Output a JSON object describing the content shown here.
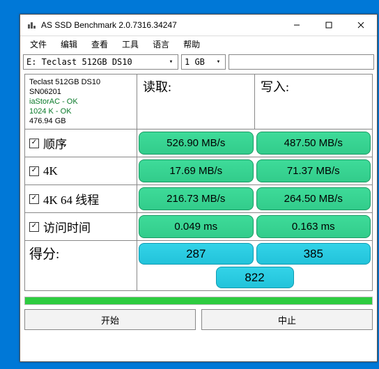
{
  "window": {
    "title": "AS SSD Benchmark 2.0.7316.34247"
  },
  "menu": {
    "file": "文件",
    "edit": "编辑",
    "view": "查看",
    "tools": "工具",
    "language": "语言",
    "help": "帮助"
  },
  "toolbar": {
    "drive": "E: Teclast 512GB DS10",
    "size": "1 GB",
    "search": ""
  },
  "info": {
    "model": "Teclast 512GB DS10",
    "serial": "SN06201",
    "driver": "iaStorAC - OK",
    "align": "1024 K - OK",
    "capacity": "476.94 GB"
  },
  "headers": {
    "read": "读取:",
    "write": "写入:"
  },
  "rows": {
    "seq": {
      "label": "顺序",
      "read": "526.90 MB/s",
      "write": "487.50 MB/s"
    },
    "r4k": {
      "label": "4K",
      "read": "17.69 MB/s",
      "write": "71.37 MB/s"
    },
    "r4k64": {
      "label": "4K 64 线程",
      "read": "216.73 MB/s",
      "write": "264.50 MB/s"
    },
    "access": {
      "label": "访问时间",
      "read": "0.049 ms",
      "write": "0.163 ms"
    }
  },
  "score": {
    "label": "得分:",
    "read": "287",
    "write": "385",
    "total": "822"
  },
  "buttons": {
    "start": "开始",
    "abort": "中止"
  }
}
